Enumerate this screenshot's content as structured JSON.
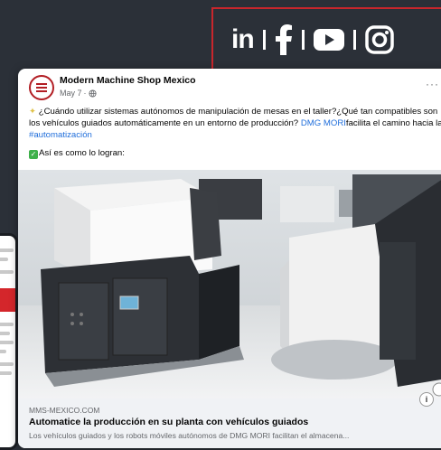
{
  "social": {
    "linkedin_label": "in",
    "icons": [
      "linkedin-icon",
      "facebook-icon",
      "youtube-icon",
      "instagram-icon"
    ],
    "border_color": "#c8262c"
  },
  "post": {
    "page_name": "Modern Machine Shop Mexico",
    "date": "May 7",
    "separator": "·",
    "more": "···",
    "text_main": "¿Cuándo utilizar sistemas autónomos de manipulación de mesas en el taller?¿Qué tan compatibles son los vehículos guiados automáticamente en un entorno de producción? ",
    "text_brand": "DMG MORI",
    "text_mid": "facilita el camino hacia la ",
    "hashtag": "#automatización",
    "text_line2": "Así es como lo logran:",
    "link_domain": "MMS-MEXICO.COM",
    "link_title": "Automatice la producción en su planta con vehículos guiados",
    "link_desc": "Los vehículos guiados y los robots móviles autónomos de DMG MORI facilitan el almacena...",
    "info": "i"
  },
  "colors": {
    "background": "#2b3038",
    "link": "#216fdb",
    "brand_red": "#b21e24"
  }
}
